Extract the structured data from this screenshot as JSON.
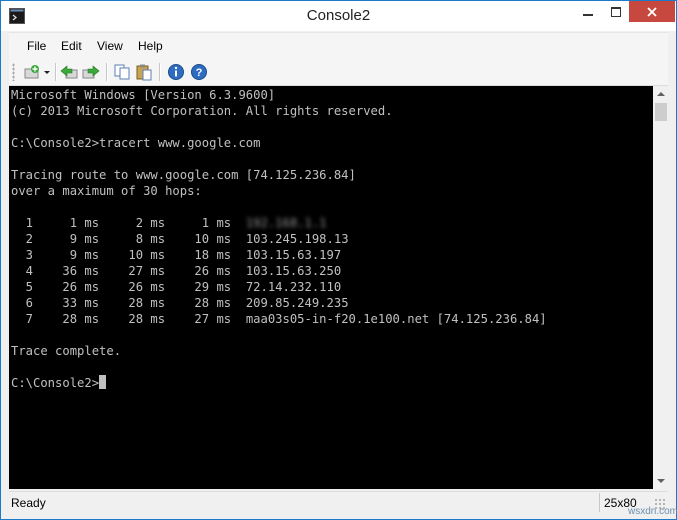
{
  "window": {
    "title": "Console2"
  },
  "menu": [
    "File",
    "Edit",
    "View",
    "Help"
  ],
  "toolbar": {
    "tools": [
      {
        "name": "new-tab-button",
        "icon": "new-tab-icon"
      },
      {
        "name": "new-tab-dropdown-button",
        "icon": "dropdown-arrow-icon"
      },
      {
        "name": "previous-tab-button",
        "icon": "arrow-left-icon"
      },
      {
        "name": "next-tab-button",
        "icon": "arrow-right-icon"
      },
      {
        "name": "copy-button",
        "icon": "copy-icon"
      },
      {
        "name": "paste-button",
        "icon": "paste-icon"
      },
      {
        "name": "about-button",
        "icon": "info-icon"
      },
      {
        "name": "help-button",
        "icon": "help-icon"
      }
    ]
  },
  "console": {
    "lines": [
      "Microsoft Windows [Version 6.3.9600]",
      "(c) 2013 Microsoft Corporation. All rights reserved.",
      "",
      "C:\\Console2>tracert www.google.com",
      "",
      "Tracing route to www.google.com [74.125.236.84]",
      "over a maximum of 30 hops:",
      ""
    ],
    "hops": [
      {
        "hop": "1",
        "t1": "1 ms",
        "t2": "2 ms",
        "t3": "1 ms",
        "host": "192.168.1.1",
        "blurred": true
      },
      {
        "hop": "2",
        "t1": "9 ms",
        "t2": "8 ms",
        "t3": "10 ms",
        "host": "103.245.198.13"
      },
      {
        "hop": "3",
        "t1": "9 ms",
        "t2": "10 ms",
        "t3": "18 ms",
        "host": "103.15.63.197"
      },
      {
        "hop": "4",
        "t1": "36 ms",
        "t2": "27 ms",
        "t3": "26 ms",
        "host": "103.15.63.250"
      },
      {
        "hop": "5",
        "t1": "26 ms",
        "t2": "26 ms",
        "t3": "29 ms",
        "host": "72.14.232.110"
      },
      {
        "hop": "6",
        "t1": "33 ms",
        "t2": "28 ms",
        "t3": "28 ms",
        "host": "209.85.249.235"
      },
      {
        "hop": "7",
        "t1": "28 ms",
        "t2": "28 ms",
        "t3": "27 ms",
        "host": "maa03s05-in-f20.1e100.net [74.125.236.84]"
      }
    ],
    "trailer": [
      "",
      "Trace complete.",
      ""
    ],
    "prompt": "C:\\Console2>"
  },
  "status": {
    "text": "Ready",
    "size": "25x80"
  },
  "watermark": "wsxdn.com"
}
